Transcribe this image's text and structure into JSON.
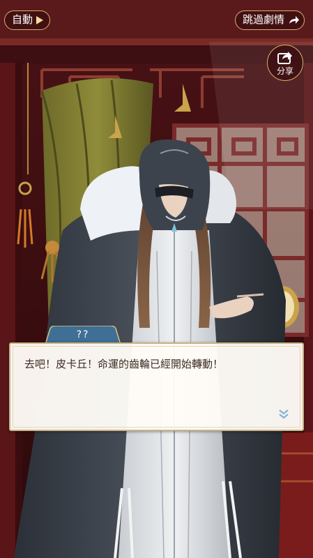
{
  "hud": {
    "auto_label": "自動",
    "skip_label": "跳過劇情",
    "share_label": "分享"
  },
  "dialogue": {
    "speaker": "??",
    "text": "去吧！皮卡丘！命運的齒輪已經開始轉動！"
  },
  "icons": {
    "auto": "play-triangle-icon",
    "skip": "forward-arrow-icon",
    "share": "share-arrow-icon",
    "next": "double-chevron-down-icon"
  },
  "colors": {
    "gold_trim": "#d6b36d",
    "pill_bg": "#3c0e10",
    "dialogue_bg": "#fffcf7",
    "dialogue_text": "#3b2a23",
    "name_plate": "#3f6f95",
    "next_indicator": "#7fb3dc"
  }
}
